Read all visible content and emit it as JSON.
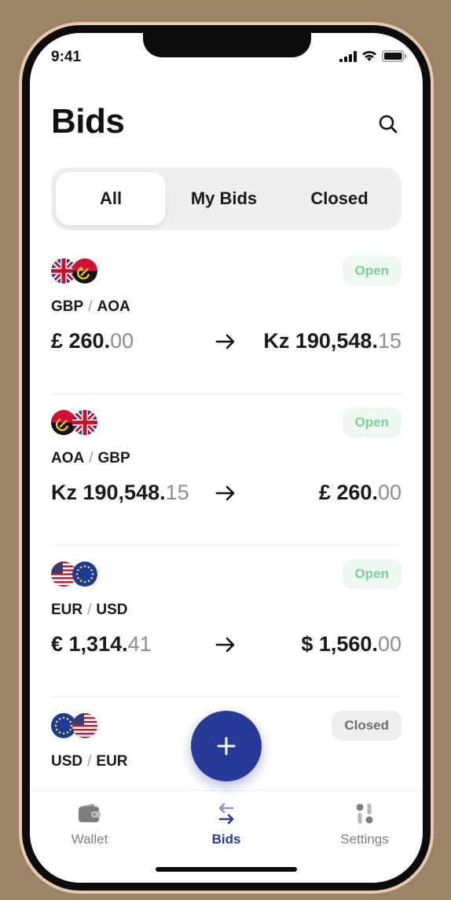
{
  "status_bar": {
    "time": "9:41"
  },
  "header": {
    "title": "Bids"
  },
  "segments": [
    {
      "label": "All",
      "active": true
    },
    {
      "label": "My Bids",
      "active": false
    },
    {
      "label": "Closed",
      "active": false
    }
  ],
  "bids": [
    {
      "flags": [
        "uk-flag",
        "angola-flag"
      ],
      "status": "Open",
      "from_currency": "GBP",
      "separator": "/",
      "to_currency": "AOA",
      "from_amount": {
        "main": "£ 260.",
        "decimals": "00"
      },
      "to_amount": {
        "main": "Kz 190,548.",
        "decimals": "15"
      }
    },
    {
      "flags": [
        "angola-flag",
        "uk-flag"
      ],
      "status": "Open",
      "from_currency": "AOA",
      "separator": "/",
      "to_currency": "GBP",
      "from_amount": {
        "main": "Kz 190,548.",
        "decimals": "15"
      },
      "to_amount": {
        "main": "£ 260.",
        "decimals": "00"
      }
    },
    {
      "flags": [
        "us-flag",
        "eu-flag"
      ],
      "status": "Open",
      "from_currency": "EUR",
      "separator": "/",
      "to_currency": "USD",
      "from_amount": {
        "main": "€ 1,314.",
        "decimals": "41"
      },
      "to_amount": {
        "main": "$ 1,560.",
        "decimals": "00"
      }
    },
    {
      "flags": [
        "eu-flag",
        "us-flag"
      ],
      "status": "Closed",
      "from_currency": "USD",
      "separator": "/",
      "to_currency": "EUR"
    }
  ],
  "fab": {
    "icon": "plus-icon"
  },
  "tabbar": {
    "wallet": "Wallet",
    "bids": "Bids",
    "settings": "Settings"
  },
  "colors": {
    "accent": "#263a96",
    "open_bg": "#eef8f1",
    "open_text": "#7ccf9a",
    "closed_bg": "#eeeeee",
    "closed_text": "#6e6e6e",
    "backdrop": "#9b8468"
  }
}
